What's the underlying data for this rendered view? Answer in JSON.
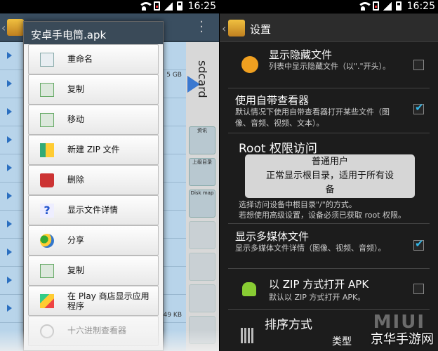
{
  "status": {
    "time": "16:25"
  },
  "left": {
    "sdcard_label": "sdcard",
    "sizes": [
      "5 GB",
      "49 KB"
    ],
    "tiles": [
      "资讯",
      "上级目录",
      "Disk map"
    ],
    "dialog": {
      "title": "安卓手电筒.apk",
      "items": [
        {
          "label": "重命名",
          "icon": "rename-icon"
        },
        {
          "label": "复制",
          "icon": "copy-icon"
        },
        {
          "label": "移动",
          "icon": "move-icon"
        },
        {
          "label": "新建 ZIP 文件",
          "icon": "zip-icon"
        },
        {
          "label": "删除",
          "icon": "trash-icon"
        },
        {
          "label": "显示文件详情",
          "icon": "help-icon"
        },
        {
          "label": "分享",
          "icon": "share-icon"
        },
        {
          "label": "复制",
          "icon": "copy-icon"
        },
        {
          "label": "在 Play 商店显示应用程序",
          "icon": "play-store-icon"
        },
        {
          "label": "十六进制查看器",
          "icon": "hex-viewer-icon"
        }
      ]
    }
  },
  "right": {
    "title": "设置",
    "settings": [
      {
        "title": "显示隐藏文件",
        "summary": "列表中显示隐藏文件（以\".\"开头）。",
        "checked": false
      },
      {
        "title": "使用自带查看器",
        "summary": "默认情况下使用自带查看器打开某些文件（图像、音频、视频、文本）。",
        "checked": true
      },
      {
        "title": "显示多媒体文件",
        "summary": "显示多媒体文件详情（图像、视频、音频）。",
        "checked": true
      },
      {
        "title": "以 ZIP 方式打开 APK",
        "summary": "默认以 ZIP 方式打开 APK。",
        "checked": false
      }
    ],
    "root_section": "Root 权限访问",
    "root_summary_1": "选择访问设备中根目录\"/\"的方式。",
    "root_summary_2": "若想使用高级设置，设备必须已获取 root 权限。",
    "toast": {
      "line1": "普通用户",
      "line2": "正常显示根目录，适用于所有设",
      "line3": "备"
    },
    "sort_section": "排序方式",
    "sort_label": "类型"
  },
  "watermark": {
    "brand": "MIUI",
    "site": "京华手游网"
  }
}
